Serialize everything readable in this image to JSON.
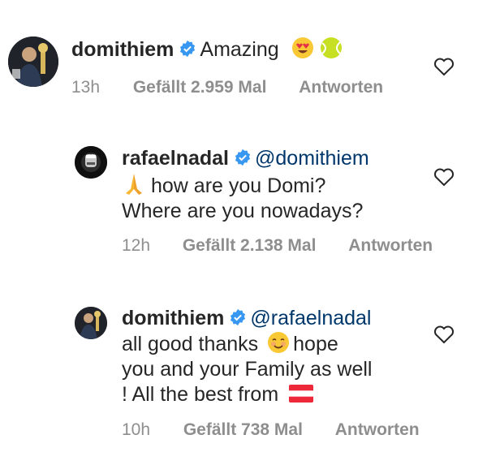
{
  "comments": [
    {
      "username": "domithiem",
      "text": "Amazing",
      "emoji": [
        "heart-eyes-emoji",
        "tennis-ball-emoji"
      ],
      "time": "13h",
      "likes": "Gefällt 2.959 Mal",
      "reply": "Antworten"
    },
    {
      "username": "rafaelnadal",
      "mention": "@domithiem",
      "text_line1": "how are you Domi?",
      "text_line2": "Where are you nowadays?",
      "emoji": [
        "folded-hands-emoji"
      ],
      "time": "12h",
      "likes": "Gefällt 2.138 Mal",
      "reply": "Antworten"
    },
    {
      "username": "domithiem",
      "mention": "@rafaelnadal",
      "text_line1a": "all good thanks",
      "text_line1b": "hope",
      "text_line2": "you and your Family as well",
      "text_line3": "! All the best from",
      "emoji": [
        "smiling-face-emoji",
        "austria-flag-emoji"
      ],
      "time": "10h",
      "likes": "Gefällt 738 Mal",
      "reply": "Antworten"
    }
  ]
}
